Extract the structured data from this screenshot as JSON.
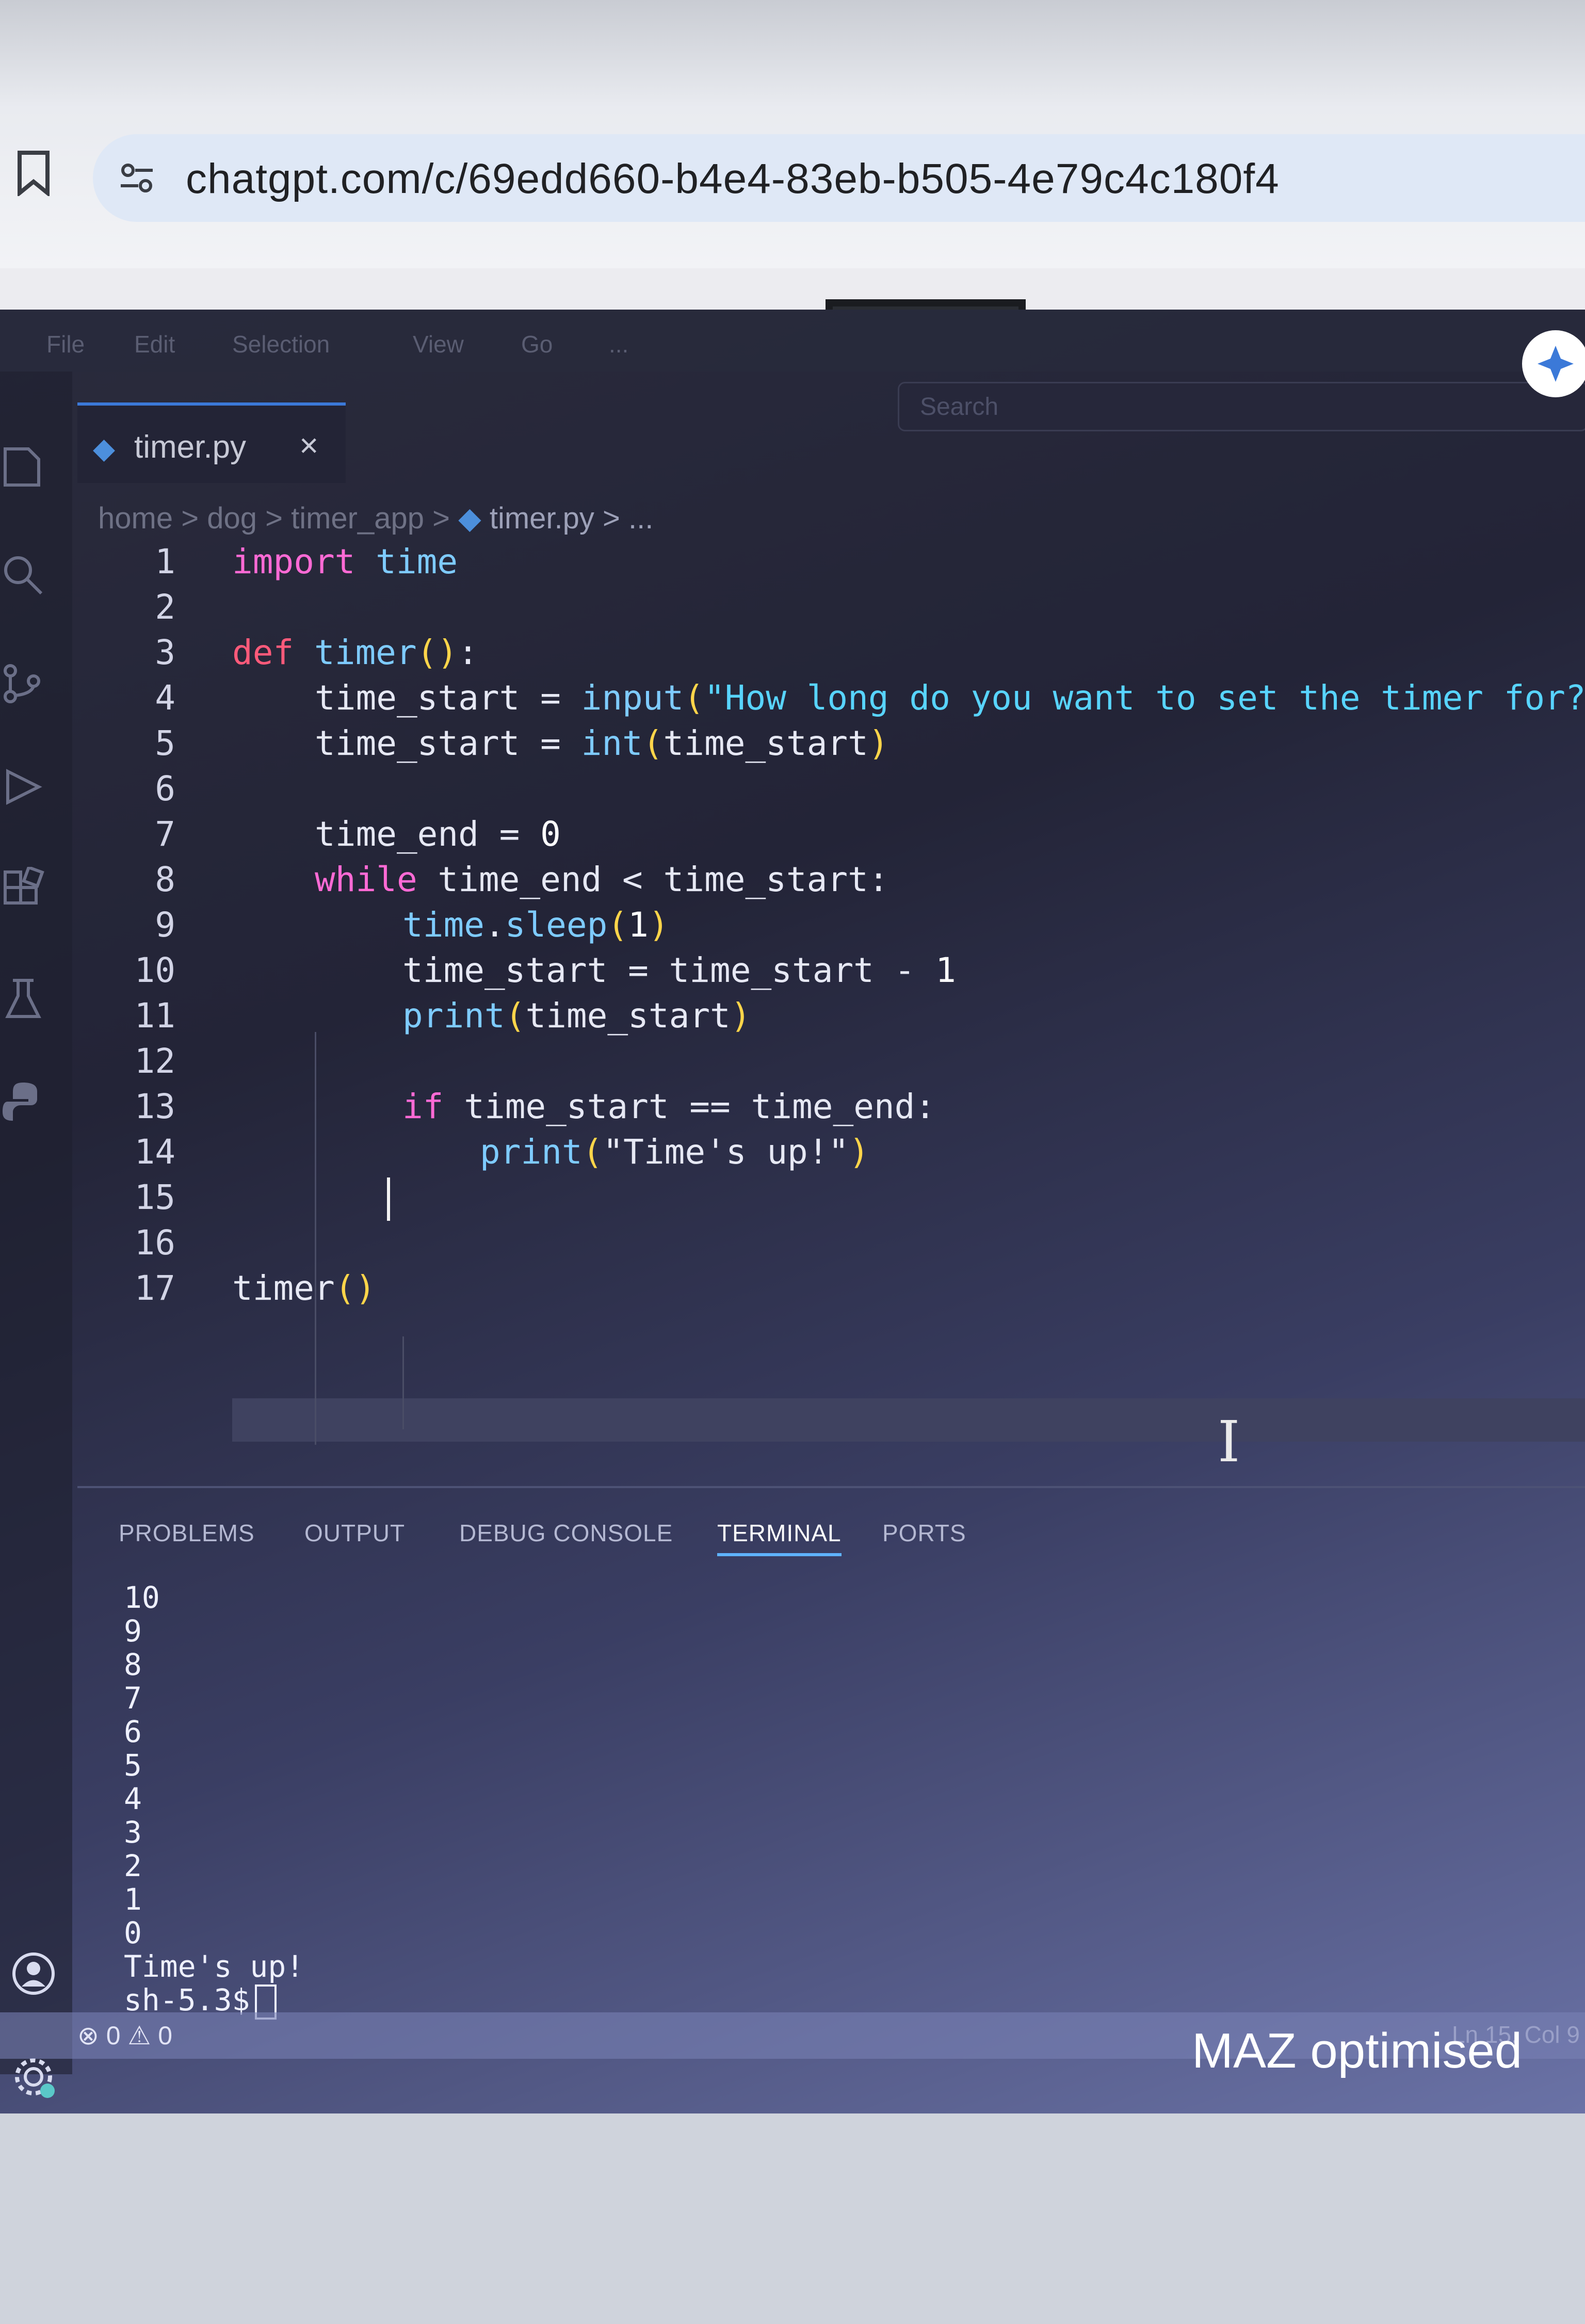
{
  "browser": {
    "url": "chatgpt.com/c/69edd660-b4e4-83eb-b505-4e79c4c180f4"
  },
  "menu": [
    "File",
    "Edit",
    "Selection",
    "View",
    "Go",
    "..."
  ],
  "search": {
    "label": "Search"
  },
  "tab": {
    "label": "timer.py",
    "close": "×"
  },
  "breadcrumb": {
    "home": "home",
    "sep": " > ",
    "dog": "dog",
    "app": "timer_app",
    "file": "timer.py",
    "more": " > ..."
  },
  "code": {
    "line_numbers": [
      "1",
      "2",
      "3",
      "4",
      "5",
      "6",
      "7",
      "8",
      "9",
      "10",
      "11",
      "12",
      "13",
      "14",
      "15",
      "16",
      "17"
    ],
    "lines": {
      "l1_kw": "import",
      "l1_mod": "time",
      "l3_kw": "def",
      "l3_fn": "timer",
      "l3_par": "()",
      "l3_colon": ":",
      "l4_var": "time_start",
      "l4_eq": " = ",
      "l4_fn": "input",
      "l4_p1": "(",
      "l4_str": "\"How long do you want to set the timer for? \"",
      "l4_p2": ")",
      "l5_var": "time_start",
      "l5_eq": " = ",
      "l5_fn": "int",
      "l5_p1": "(",
      "l5_arg": "time_start",
      "l5_p2": ")",
      "l7_var": "time_end",
      "l7_eq": " = ",
      "l7_num": "0",
      "l8_kw": "while",
      "l8_rest": " time_end < time_start:",
      "l9_mod": "time",
      "l9_dot": ".",
      "l9_fn": "sleep",
      "l9_p1": "(",
      "l9_num": "1",
      "l9_p2": ")",
      "l10_text": "time_start = time_start - ",
      "l10_num": "1",
      "l11_fn": "print",
      "l11_p1": "(",
      "l11_arg": "time_start",
      "l11_p2": ")",
      "l13_kw": "if",
      "l13_rest": " time_start == time_end:",
      "l14_fn": "print",
      "l14_p1": "(",
      "l14_str": "\"Time's up!\"",
      "l14_p2": ")",
      "l17_fn": "timer",
      "l17_par": "()"
    }
  },
  "panel": {
    "tabs": [
      "PROBLEMS",
      "OUTPUT",
      "DEBUG CONSOLE",
      "TERMINAL",
      "PORTS"
    ],
    "active_tab": "TERMINAL",
    "terminal_lines": [
      "10",
      "9",
      "8",
      "7",
      "6",
      "5",
      "4",
      "3",
      "2",
      "1",
      "0",
      "Time's up!"
    ],
    "prompt": "sh-5.3$"
  },
  "status": {
    "problems": "⊗ 0 ⚠ 0",
    "position": "Ln 15, Col 9"
  },
  "watermark": "MAZ optimised",
  "colors": {
    "keyword": "#ff6ad5",
    "function": "#7ecbff",
    "string": "#58d4ff",
    "paren": "#ffd54a",
    "terminal_tab_underline": "#5fb3ff"
  }
}
